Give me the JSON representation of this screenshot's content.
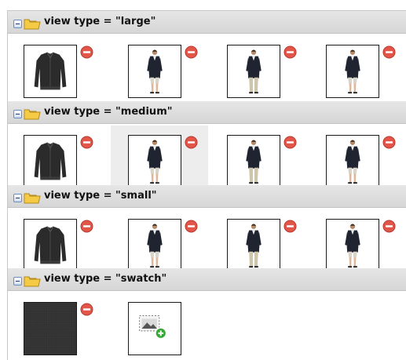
{
  "groups": [
    {
      "title": "view type = \"large\"",
      "items": [
        {
          "kind": "jacket",
          "alt": "",
          "removable": true
        },
        {
          "kind": "model-shorts",
          "alt": "",
          "removable": true
        },
        {
          "kind": "model-pants",
          "alt": "",
          "removable": true
        },
        {
          "kind": "model-shorts",
          "alt": "",
          "removable": true
        }
      ]
    },
    {
      "title": "view type = \"medium\"",
      "items": [
        {
          "kind": "jacket",
          "alt": "",
          "removable": true
        },
        {
          "kind": "model-shorts",
          "alt": "",
          "removable": true
        },
        {
          "kind": "model-pants",
          "alt": "",
          "removable": true
        },
        {
          "kind": "model-shorts",
          "alt": "",
          "removable": true
        }
      ]
    },
    {
      "title": "view type = \"small\"",
      "items": [
        {
          "kind": "jacket",
          "alt": "",
          "removable": true
        },
        {
          "kind": "model-shorts",
          "alt": "",
          "removable": true
        },
        {
          "kind": "model-pants",
          "alt": "",
          "removable": true
        },
        {
          "kind": "model-shorts",
          "alt": "",
          "removable": true
        }
      ]
    },
    {
      "title": "view type = \"swatch\"",
      "items": [
        {
          "kind": "swatch",
          "removable": true
        },
        {
          "kind": "add-image"
        }
      ]
    }
  ],
  "colors": {
    "remove": "#e2564a",
    "add": "#36a836",
    "folder": "#f5cb45",
    "header": "#dcdcdc",
    "toggle": "#6a8fbf"
  },
  "icons": [
    "collapse-icon",
    "folder-icon",
    "remove-icon",
    "add-image-icon"
  ]
}
